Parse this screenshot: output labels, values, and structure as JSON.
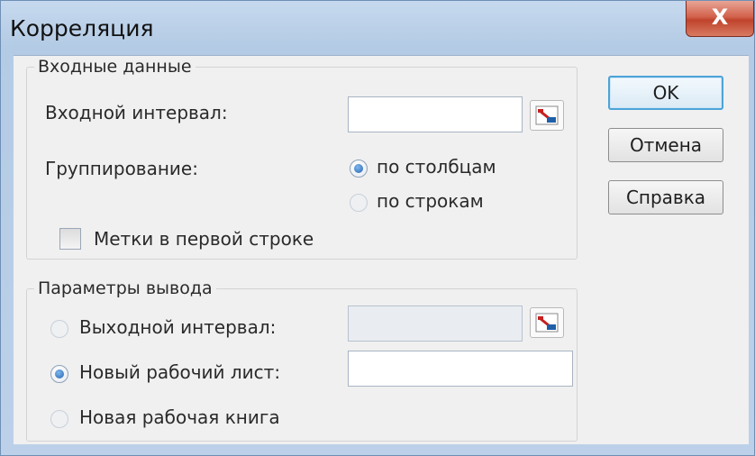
{
  "window": {
    "title": "Корреляция",
    "close_label": "X"
  },
  "input_group": {
    "caption": "Входные данные",
    "input_range_label": "Входной интервал:",
    "input_range_value": "",
    "grouping_label": "Группирование:",
    "grouping_options": [
      {
        "label": "по столбцам",
        "selected": true
      },
      {
        "label": "по строкам",
        "selected": false
      }
    ],
    "labels_checkbox_label": "Метки в первой строке",
    "labels_checkbox_checked": false
  },
  "output_group": {
    "caption": "Параметры вывода",
    "options": [
      {
        "label": "Выходной интервал:",
        "selected": false
      },
      {
        "label": "Новый рабочий лист:",
        "selected": true
      },
      {
        "label": "Новая рабочая книга",
        "selected": false
      }
    ],
    "output_range_value": "",
    "new_sheet_value": ""
  },
  "buttons": {
    "ok": "OK",
    "cancel": "Отмена",
    "help": "Справка"
  },
  "icons": {
    "ref_button": "range-select-icon",
    "close": "close-icon"
  },
  "colors": {
    "accent": "#4ca3d8",
    "close": "#c0432c",
    "radio_selected": "#2d6bb8"
  }
}
